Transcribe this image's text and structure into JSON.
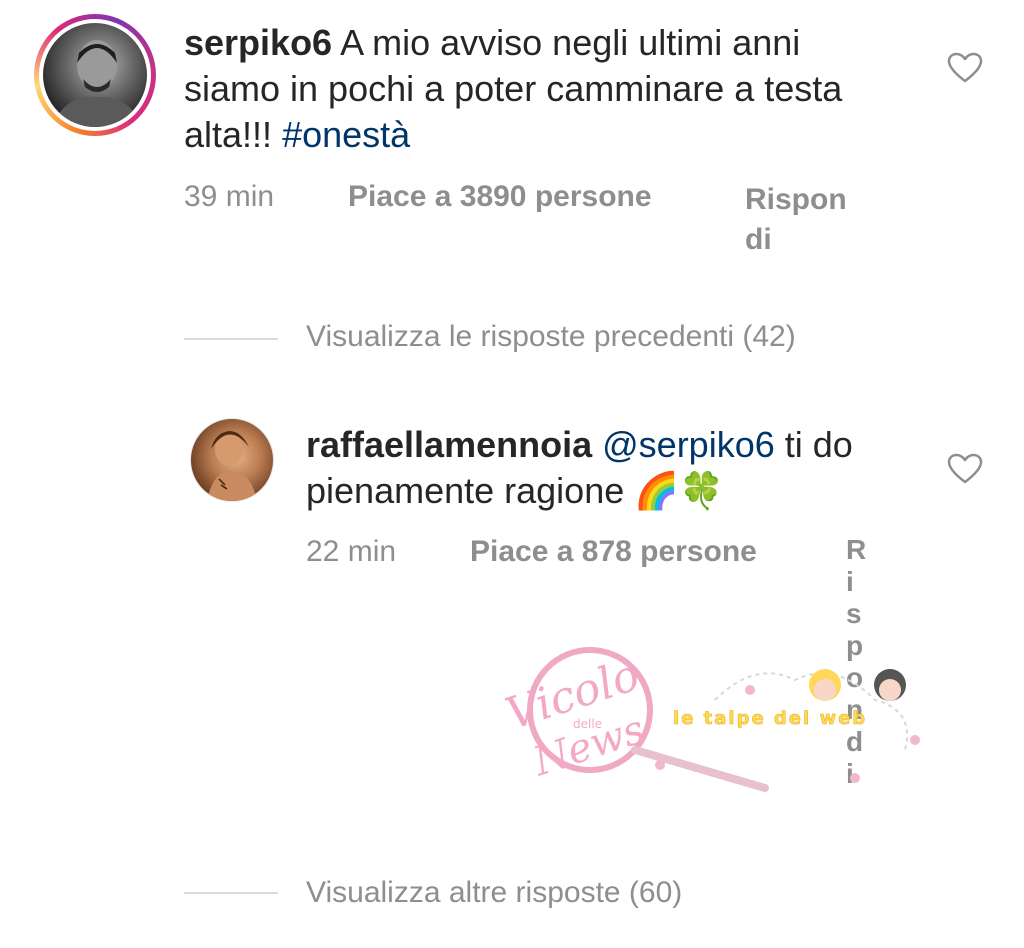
{
  "comment": {
    "username": "serpiko6",
    "text": "A mio avviso negli ultimi anni siamo in pochi a poter camminare a testa alta!!!",
    "hashtag": "#onestà",
    "time": "39 min",
    "likes": "Piace a 3890 persone",
    "reply_line1": "Rispon",
    "reply_line2": "di"
  },
  "view_previous": "Visualizza le risposte precedenti (42)",
  "reply": {
    "username": "raffaellamennoia",
    "mention": "@serpiko6",
    "text_line1": "ti do",
    "text_line2": "pienamente ragione",
    "emoji": "🌈🍀",
    "time": "22 min",
    "likes": "Piace a 878 persone",
    "reply_vertical": "Rispondi"
  },
  "view_more": "Visualizza altre risposte (60)",
  "watermark": {
    "logo_text": "Vicolo",
    "logo_small": "delle",
    "logo_text2": "News",
    "tagline": "le talpe del web"
  },
  "colors": {
    "hashtag": "#003569",
    "meta": "#8e8e8e"
  }
}
